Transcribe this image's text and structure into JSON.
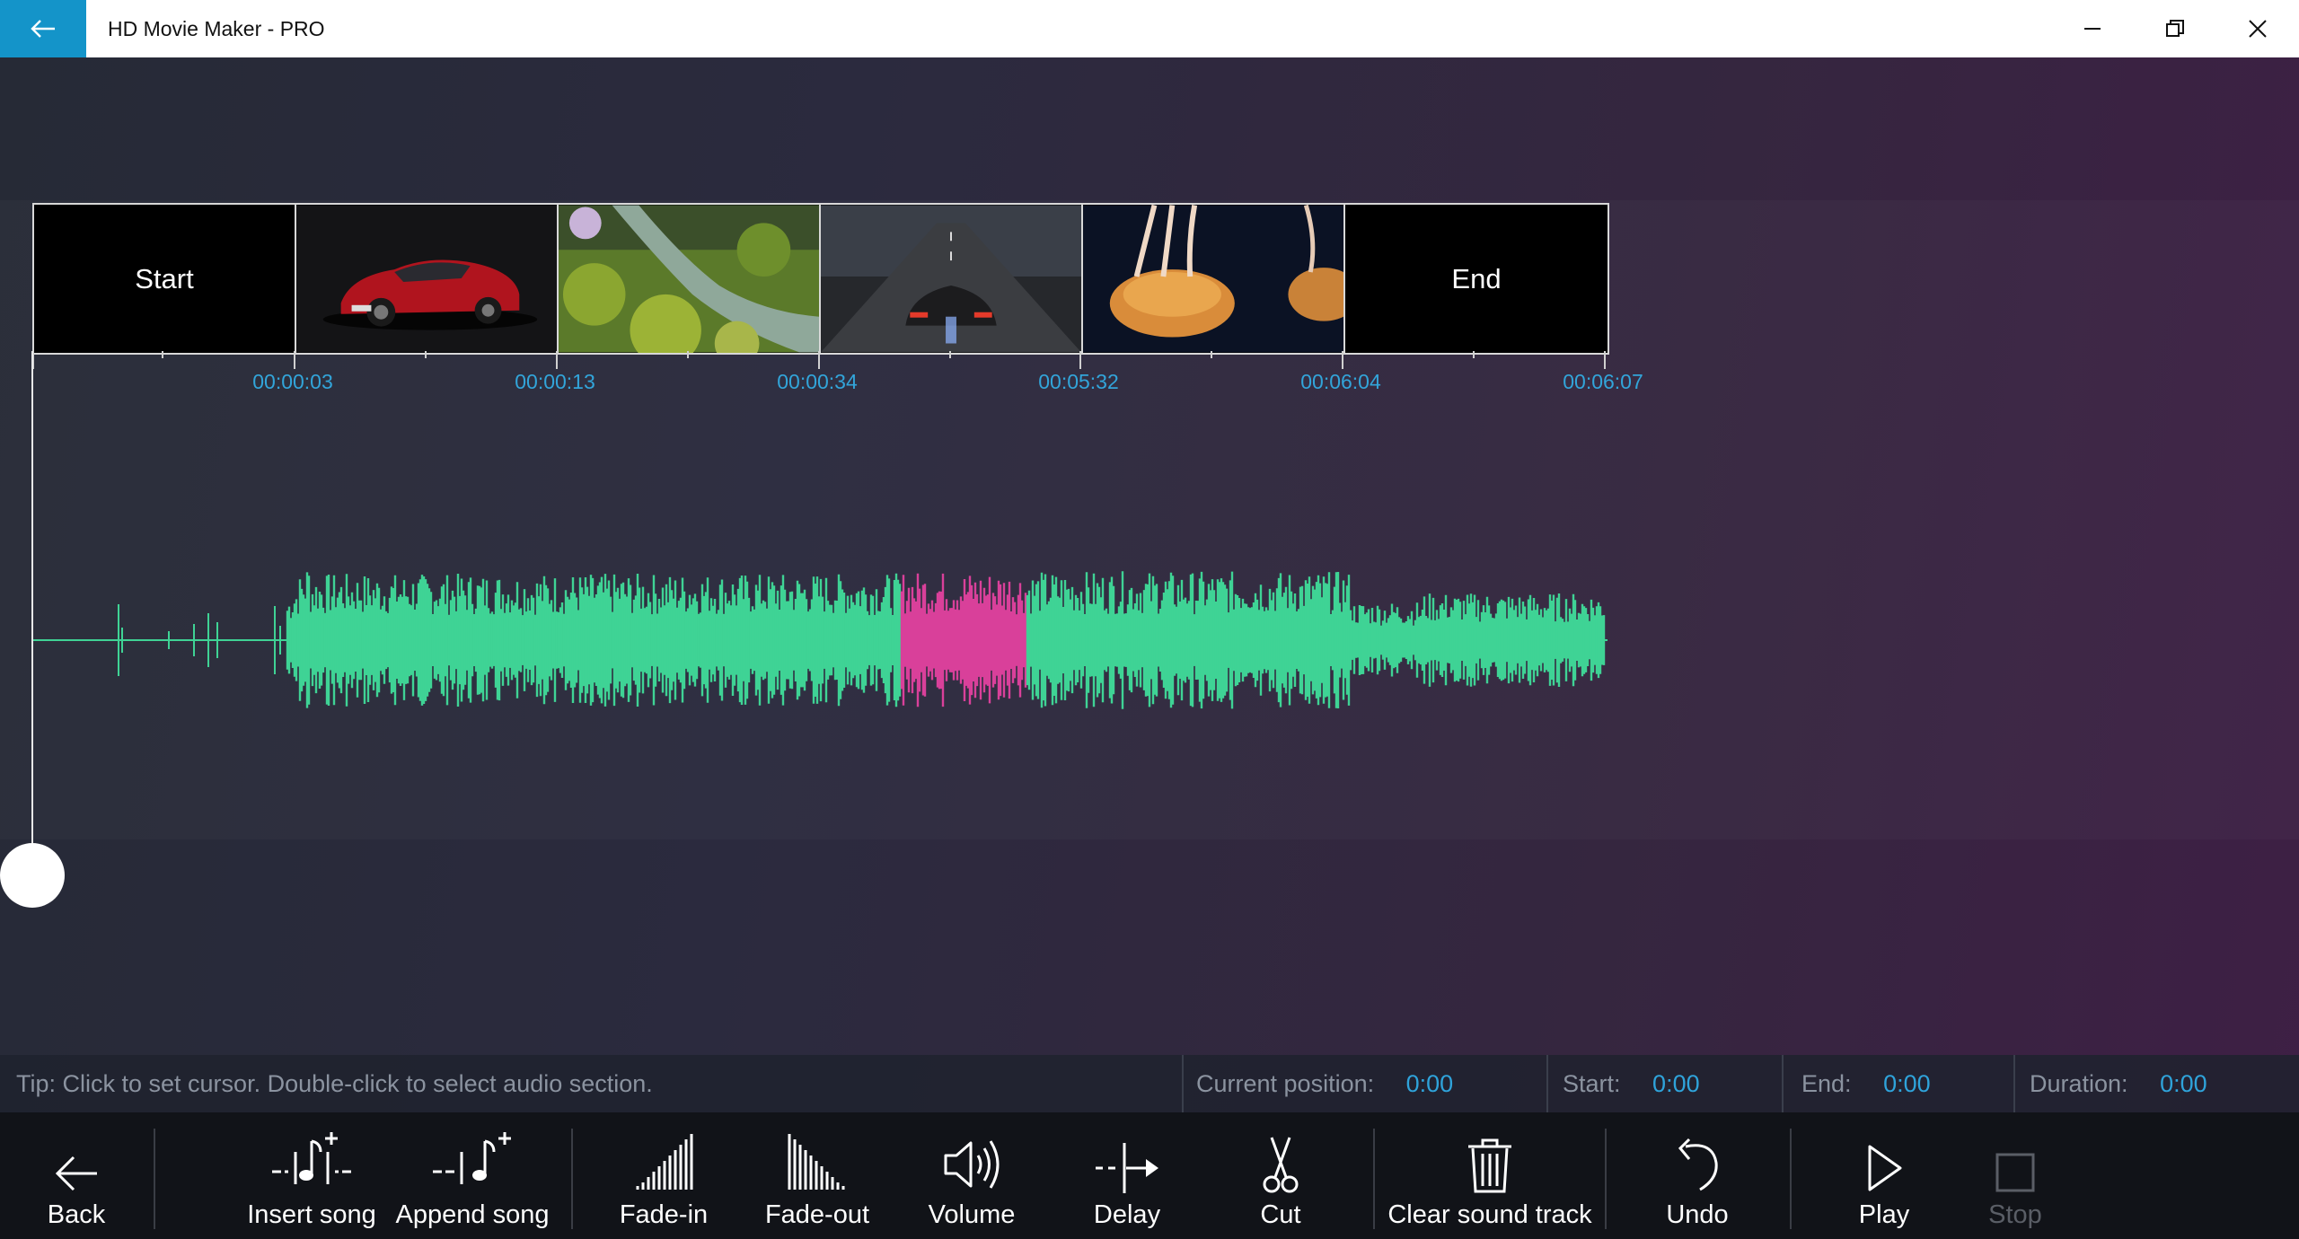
{
  "app": {
    "title": "HD Movie Maker - PRO"
  },
  "timeline": {
    "clips": [
      {
        "type": "label",
        "label": "Start"
      },
      {
        "type": "image",
        "name": "red-car-thumbnail"
      },
      {
        "type": "image",
        "name": "garden-stream-thumbnail"
      },
      {
        "type": "image",
        "name": "sports-car-road-thumbnail"
      },
      {
        "type": "image",
        "name": "jellyfish-thumbnail"
      },
      {
        "type": "label",
        "label": "End"
      }
    ],
    "times": [
      "00:00:03",
      "00:00:13",
      "00:00:34",
      "00:05:32",
      "00:06:04",
      "00:06:07"
    ]
  },
  "status": {
    "tip": "Tip: Click to set cursor. Double-click to select audio section.",
    "current_position_label": "Current position:",
    "current_position_value": "0:00",
    "start_label": "Start:",
    "start_value": "0:00",
    "end_label": "End:",
    "end_value": "0:00",
    "duration_label": "Duration:",
    "duration_value": "0:00"
  },
  "toolbar": {
    "back": "Back",
    "insert_song": "Insert song",
    "append_song": "Append song",
    "fade_in": "Fade-in",
    "fade_out": "Fade-out",
    "volume": "Volume",
    "delay": "Delay",
    "cut": "Cut",
    "clear_sound_track": "Clear sound track",
    "undo": "Undo",
    "play": "Play",
    "stop": "Stop"
  },
  "colors": {
    "accent": "#1494c9",
    "waveform": "#3fd395",
    "selection": "#d9409a",
    "time_label": "#32a5da"
  }
}
